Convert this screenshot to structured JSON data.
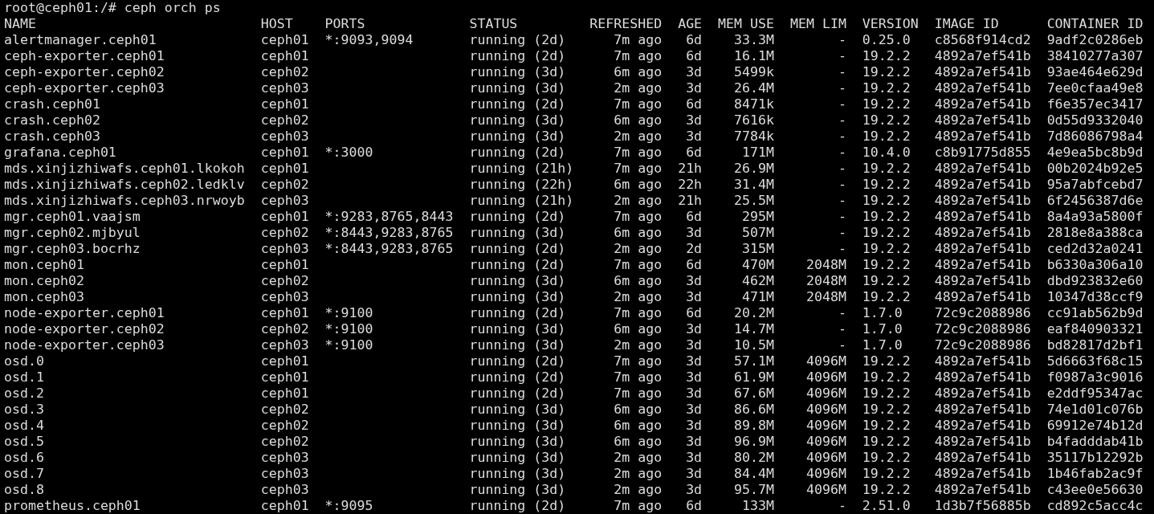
{
  "prompt": "root@ceph01:/# ceph orch ps",
  "columns": [
    "NAME",
    "HOST",
    "PORTS",
    "STATUS",
    "REFRESHED",
    "AGE",
    "MEM USE",
    "MEM LIM",
    "VERSION",
    "IMAGE ID",
    "CONTAINER ID"
  ],
  "rows": [
    {
      "name": "alertmanager.ceph01",
      "host": "ceph01",
      "ports": "*:9093,9094",
      "status": "running (2d)",
      "refreshed": "7m ago",
      "age": "6d",
      "mem_use": "33.3M",
      "mem_lim": "-",
      "version": "0.25.0",
      "image_id": "c8568f914cd2",
      "container_id": "9adf2c0286eb"
    },
    {
      "name": "ceph-exporter.ceph01",
      "host": "ceph01",
      "status": "running (2d)",
      "refreshed": "7m ago",
      "age": "6d",
      "mem_use": "16.1M",
      "mem_lim": "-",
      "version": "19.2.2",
      "image_id": "4892a7ef541b",
      "container_id": "38410277a307"
    },
    {
      "name": "ceph-exporter.ceph02",
      "host": "ceph02",
      "status": "running (3d)",
      "refreshed": "6m ago",
      "age": "3d",
      "mem_use": "5499k",
      "mem_lim": "-",
      "version": "19.2.2",
      "image_id": "4892a7ef541b",
      "container_id": "93ae464e629d"
    },
    {
      "name": "ceph-exporter.ceph03",
      "host": "ceph03",
      "status": "running (3d)",
      "refreshed": "2m ago",
      "age": "3d",
      "mem_use": "26.4M",
      "mem_lim": "-",
      "version": "19.2.2",
      "image_id": "4892a7ef541b",
      "container_id": "7ee0cfaa49e8"
    },
    {
      "name": "crash.ceph01",
      "host": "ceph01",
      "status": "running (2d)",
      "refreshed": "7m ago",
      "age": "6d",
      "mem_use": "8471k",
      "mem_lim": "-",
      "version": "19.2.2",
      "image_id": "4892a7ef541b",
      "container_id": "f6e357ec3417"
    },
    {
      "name": "crash.ceph02",
      "host": "ceph02",
      "status": "running (3d)",
      "refreshed": "6m ago",
      "age": "3d",
      "mem_use": "7616k",
      "mem_lim": "-",
      "version": "19.2.2",
      "image_id": "4892a7ef541b",
      "container_id": "0d55d9332040"
    },
    {
      "name": "crash.ceph03",
      "host": "ceph03",
      "status": "running (3d)",
      "refreshed": "2m ago",
      "age": "3d",
      "mem_use": "7784k",
      "mem_lim": "-",
      "version": "19.2.2",
      "image_id": "4892a7ef541b",
      "container_id": "7d86086798a4"
    },
    {
      "name": "grafana.ceph01",
      "host": "ceph01",
      "ports": "*:3000",
      "status": "running (2d)",
      "refreshed": "7m ago",
      "age": "6d",
      "mem_use": "171M",
      "mem_lim": "-",
      "version": "10.4.0",
      "image_id": "c8b91775d855",
      "container_id": "4e9ea5bc8b9d"
    },
    {
      "name": "mds.xinjizhiwafs.ceph01.lkokoh",
      "host": "ceph01",
      "status": "running (21h)",
      "refreshed": "7m ago",
      "age": "21h",
      "mem_use": "26.9M",
      "mem_lim": "-",
      "version": "19.2.2",
      "image_id": "4892a7ef541b",
      "container_id": "00b2024b92e5"
    },
    {
      "name": "mds.xinjizhiwafs.ceph02.ledklv",
      "host": "ceph02",
      "status": "running (22h)",
      "refreshed": "6m ago",
      "age": "22h",
      "mem_use": "31.4M",
      "mem_lim": "-",
      "version": "19.2.2",
      "image_id": "4892a7ef541b",
      "container_id": "95a7abfcebd7"
    },
    {
      "name": "mds.xinjizhiwafs.ceph03.nrwoyb",
      "host": "ceph03",
      "status": "running (21h)",
      "refreshed": "2m ago",
      "age": "21h",
      "mem_use": "25.5M",
      "mem_lim": "-",
      "version": "19.2.2",
      "image_id": "4892a7ef541b",
      "container_id": "6f2456387d6e"
    },
    {
      "name": "mgr.ceph01.vaajsm",
      "host": "ceph01",
      "ports": "*:9283,8765,8443",
      "status": "running (2d)",
      "refreshed": "7m ago",
      "age": "6d",
      "mem_use": "295M",
      "mem_lim": "-",
      "version": "19.2.2",
      "image_id": "4892a7ef541b",
      "container_id": "8a4a93a5800f"
    },
    {
      "name": "mgr.ceph02.mjbyul",
      "host": "ceph02",
      "ports": "*:8443,9283,8765",
      "status": "running (3d)",
      "refreshed": "6m ago",
      "age": "3d",
      "mem_use": "507M",
      "mem_lim": "-",
      "version": "19.2.2",
      "image_id": "4892a7ef541b",
      "container_id": "2818e8a388ca"
    },
    {
      "name": "mgr.ceph03.bocrhz",
      "host": "ceph03",
      "ports": "*:8443,9283,8765",
      "status": "running (2d)",
      "refreshed": "2m ago",
      "age": "2d",
      "mem_use": "315M",
      "mem_lim": "-",
      "version": "19.2.2",
      "image_id": "4892a7ef541b",
      "container_id": "ced2d32a0241"
    },
    {
      "name": "mon.ceph01",
      "host": "ceph01",
      "status": "running (2d)",
      "refreshed": "7m ago",
      "age": "6d",
      "mem_use": "470M",
      "mem_lim": "2048M",
      "version": "19.2.2",
      "image_id": "4892a7ef541b",
      "container_id": "b6330a306a10"
    },
    {
      "name": "mon.ceph02",
      "host": "ceph02",
      "status": "running (3d)",
      "refreshed": "6m ago",
      "age": "3d",
      "mem_use": "462M",
      "mem_lim": "2048M",
      "version": "19.2.2",
      "image_id": "4892a7ef541b",
      "container_id": "dbd923832e60"
    },
    {
      "name": "mon.ceph03",
      "host": "ceph03",
      "status": "running (3d)",
      "refreshed": "2m ago",
      "age": "3d",
      "mem_use": "471M",
      "mem_lim": "2048M",
      "version": "19.2.2",
      "image_id": "4892a7ef541b",
      "container_id": "10347d38ccf9"
    },
    {
      "name": "node-exporter.ceph01",
      "host": "ceph01",
      "ports": "*:9100",
      "status": "running (2d)",
      "refreshed": "7m ago",
      "age": "6d",
      "mem_use": "20.2M",
      "mem_lim": "-",
      "version": "1.7.0",
      "image_id": "72c9c2088986",
      "container_id": "cc91ab562b9d"
    },
    {
      "name": "node-exporter.ceph02",
      "host": "ceph02",
      "ports": "*:9100",
      "status": "running (3d)",
      "refreshed": "6m ago",
      "age": "3d",
      "mem_use": "14.7M",
      "mem_lim": "-",
      "version": "1.7.0",
      "image_id": "72c9c2088986",
      "container_id": "eaf840903321"
    },
    {
      "name": "node-exporter.ceph03",
      "host": "ceph03",
      "ports": "*:9100",
      "status": "running (3d)",
      "refreshed": "2m ago",
      "age": "3d",
      "mem_use": "10.5M",
      "mem_lim": "-",
      "version": "1.7.0",
      "image_id": "72c9c2088986",
      "container_id": "bd82817d2bf1"
    },
    {
      "name": "osd.0",
      "host": "ceph01",
      "status": "running (2d)",
      "refreshed": "7m ago",
      "age": "3d",
      "mem_use": "57.1M",
      "mem_lim": "4096M",
      "version": "19.2.2",
      "image_id": "4892a7ef541b",
      "container_id": "5d6663f68c15"
    },
    {
      "name": "osd.1",
      "host": "ceph01",
      "status": "running (2d)",
      "refreshed": "7m ago",
      "age": "3d",
      "mem_use": "61.9M",
      "mem_lim": "4096M",
      "version": "19.2.2",
      "image_id": "4892a7ef541b",
      "container_id": "f0987a3c9016"
    },
    {
      "name": "osd.2",
      "host": "ceph01",
      "status": "running (2d)",
      "refreshed": "7m ago",
      "age": "3d",
      "mem_use": "67.6M",
      "mem_lim": "4096M",
      "version": "19.2.2",
      "image_id": "4892a7ef541b",
      "container_id": "e2ddf95347ac"
    },
    {
      "name": "osd.3",
      "host": "ceph02",
      "status": "running (3d)",
      "refreshed": "6m ago",
      "age": "3d",
      "mem_use": "86.6M",
      "mem_lim": "4096M",
      "version": "19.2.2",
      "image_id": "4892a7ef541b",
      "container_id": "74e1d01c076b"
    },
    {
      "name": "osd.4",
      "host": "ceph02",
      "status": "running (3d)",
      "refreshed": "6m ago",
      "age": "3d",
      "mem_use": "89.8M",
      "mem_lim": "4096M",
      "version": "19.2.2",
      "image_id": "4892a7ef541b",
      "container_id": "69912e74b12d"
    },
    {
      "name": "osd.5",
      "host": "ceph02",
      "status": "running (3d)",
      "refreshed": "6m ago",
      "age": "3d",
      "mem_use": "96.9M",
      "mem_lim": "4096M",
      "version": "19.2.2",
      "image_id": "4892a7ef541b",
      "container_id": "b4fadddab41b"
    },
    {
      "name": "osd.6",
      "host": "ceph03",
      "status": "running (3d)",
      "refreshed": "2m ago",
      "age": "3d",
      "mem_use": "80.2M",
      "mem_lim": "4096M",
      "version": "19.2.2",
      "image_id": "4892a7ef541b",
      "container_id": "35117b12292b"
    },
    {
      "name": "osd.7",
      "host": "ceph03",
      "status": "running (3d)",
      "refreshed": "2m ago",
      "age": "3d",
      "mem_use": "84.4M",
      "mem_lim": "4096M",
      "version": "19.2.2",
      "image_id": "4892a7ef541b",
      "container_id": "1b46fab2ac9f"
    },
    {
      "name": "osd.8",
      "host": "ceph03",
      "status": "running (3d)",
      "refreshed": "2m ago",
      "age": "3d",
      "mem_use": "95.7M",
      "mem_lim": "4096M",
      "version": "19.2.2",
      "image_id": "4892a7ef541b",
      "container_id": "c43ee0e56630"
    },
    {
      "name": "prometheus.ceph01",
      "host": "ceph01",
      "ports": "*:9095",
      "status": "running (2d)",
      "refreshed": "7m ago",
      "age": "6d",
      "mem_use": "133M",
      "mem_lim": "-",
      "version": "2.51.0",
      "image_id": "1d3b7f56885b",
      "container_id": "cd892c5acc4c"
    }
  ]
}
